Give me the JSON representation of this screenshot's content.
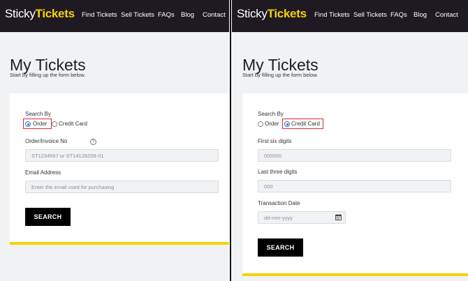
{
  "left": {
    "nav": {
      "logo_a": "Sticky",
      "logo_b": "Tickets",
      "links": [
        "Find Tickets",
        "Sell Tickets",
        "FAQs",
        "Blog",
        "Contact"
      ]
    },
    "page_title": "My Tickets",
    "subtitle": "Start by filling up the form below.",
    "search_by_label": "Search By",
    "radio_order": "Order",
    "radio_credit": "Credit Card",
    "selected": "Order",
    "order_label": "Order/Invoice No",
    "order_placeholder": "ST1234567 or ST14126209-01",
    "email_label": "Email Address",
    "email_placeholder": "Enter the email used for purchasing",
    "search_button": "SEARCH"
  },
  "right": {
    "nav": {
      "logo_a": "Sticky",
      "logo_b": "Tickets",
      "links": [
        "Find Tickets",
        "Sell Tickets",
        "FAQs",
        "Blog",
        "Contact"
      ]
    },
    "page_title": "My Tickets",
    "subtitle": "Start by filling up the form below.",
    "search_by_label": "Search By",
    "radio_order": "Order",
    "radio_credit": "Credit Card",
    "selected": "Credit Card",
    "first_six_label": "First six digits",
    "first_six_placeholder": "000000",
    "last_three_label": "Last three digits",
    "last_three_placeholder": "000",
    "date_label": "Transaction Date",
    "date_placeholder": "dd-mm-yyyy",
    "search_button": "SEARCH"
  },
  "colors": {
    "nav_bg": "#1f1a22",
    "brand_yellow": "#f5d20b",
    "highlight_red": "#e0282e",
    "radio_blue": "#2a6cd6"
  }
}
